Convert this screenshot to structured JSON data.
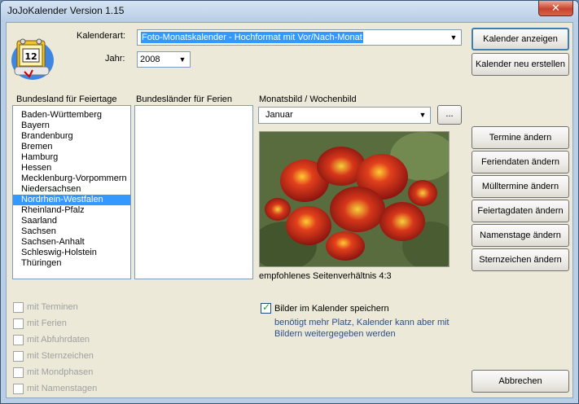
{
  "window": {
    "title": "JoJoKalender Version 1.15"
  },
  "kalenderart": {
    "label": "Kalenderart:",
    "value": "Foto-Monatskalender - Hochformat mit Vor/Nach-Monat"
  },
  "jahr": {
    "label": "Jahr:",
    "value": "2008"
  },
  "buttons": {
    "kalender_anzeigen": "Kalender anzeigen",
    "kalender_neu": "Kalender neu erstellen",
    "termine": "Termine ändern",
    "feriendaten": "Feriendaten ändern",
    "muelltermine": "Mülltermine ändern",
    "feiertagdaten": "Feiertagdaten ändern",
    "namenstage": "Namenstage ändern",
    "sternzeichen": "Sternzeichen ändern",
    "abbrechen": "Abbrechen",
    "browse": "..."
  },
  "feiertage": {
    "label": "Bundesland für Feiertage",
    "items": [
      "Baden-Württemberg",
      "Bayern",
      "Brandenburg",
      "Bremen",
      "Hamburg",
      "Hessen",
      "Mecklenburg-Vorpommern",
      "Niedersachsen",
      "Nordrhein-Westfalen",
      "Rheinland-Pfalz",
      "Saarland",
      "Sachsen",
      "Sachsen-Anhalt",
      "Schleswig-Holstein",
      "Thüringen"
    ],
    "selected": "Nordrhein-Westfalen"
  },
  "ferien": {
    "label": "Bundesländer für Ferien"
  },
  "monatsbild": {
    "label": "Monatsbild / Wochenbild",
    "value": "Januar",
    "hint": "empfohlenes Seitenverhältnis 4:3"
  },
  "options": {
    "mit_terminen": "mit Terminen",
    "mit_ferien": "mit Ferien",
    "mit_abfuhrdaten": "mit Abfuhrdaten",
    "mit_sternzeichen": "mit Sternzeichen",
    "mit_mondphasen": "mit Mondphasen",
    "mit_namenstagen": "mit Namenstagen"
  },
  "bilder": {
    "label": "Bilder im Kalender speichern",
    "checked": true,
    "note1": "benötigt mehr Platz, Kalender kann aber mit",
    "note2": "Bildern weitergegeben werden"
  }
}
